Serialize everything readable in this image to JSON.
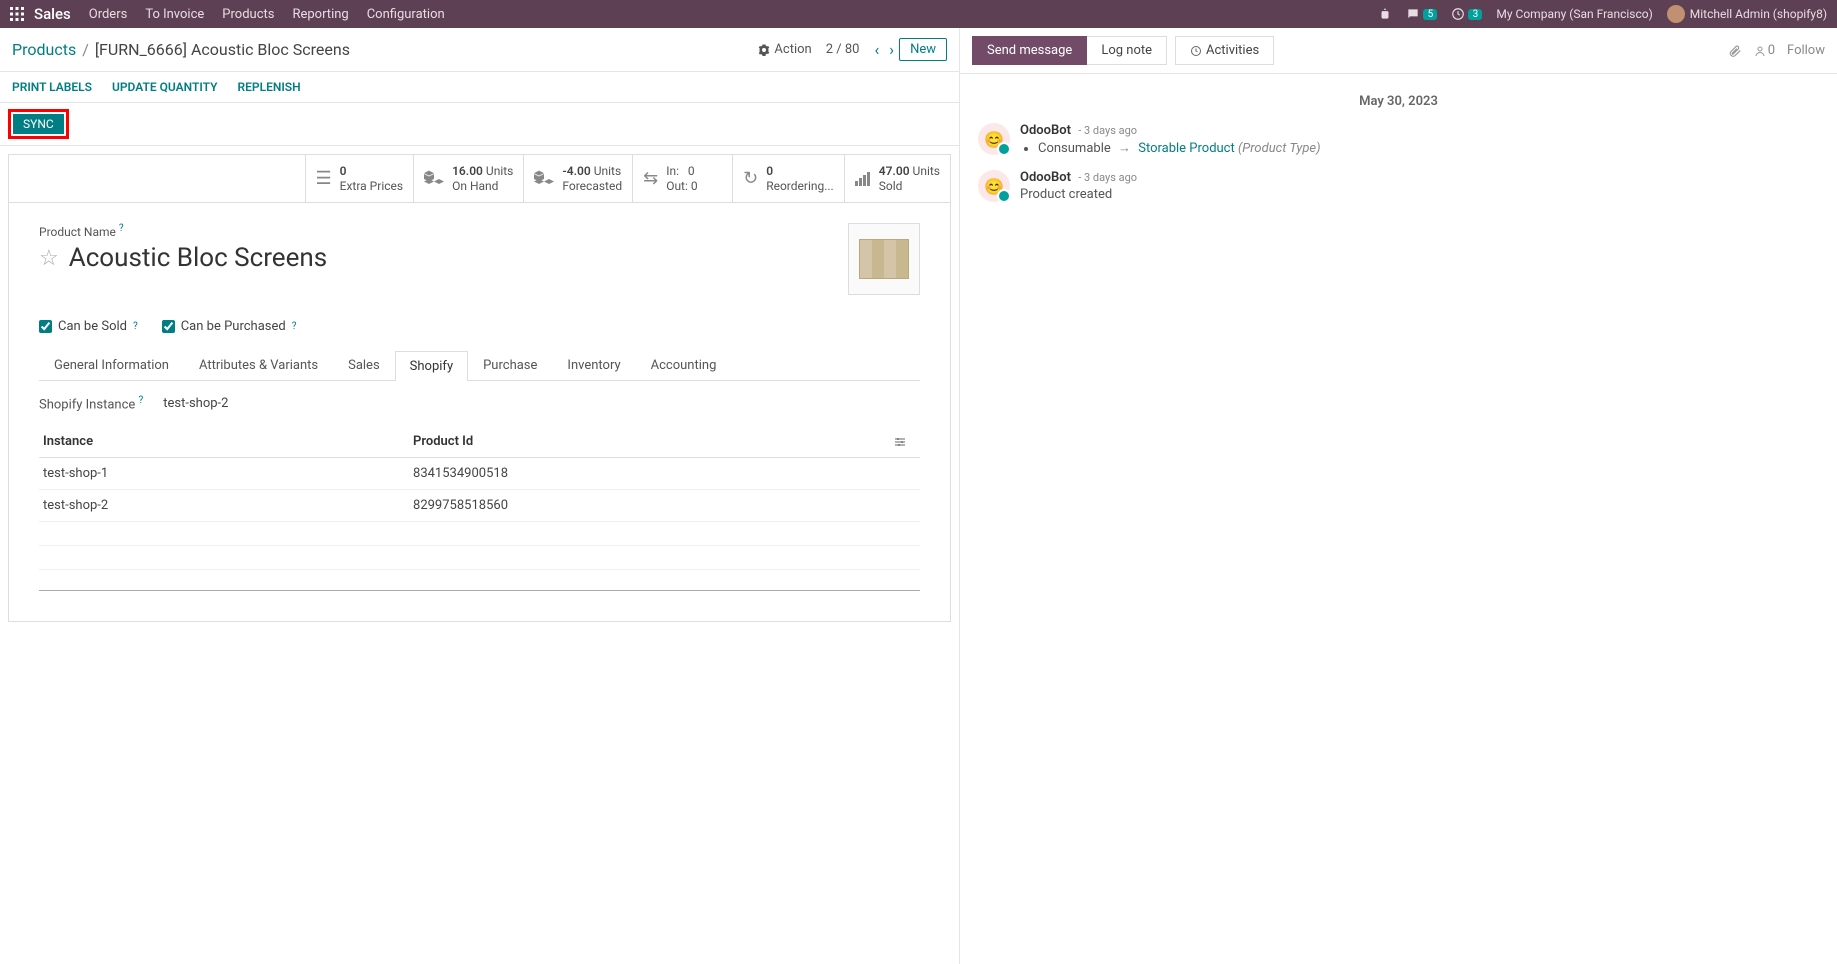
{
  "topbar": {
    "brand": "Sales",
    "menu": [
      "Orders",
      "To Invoice",
      "Products",
      "Reporting",
      "Configuration"
    ],
    "chat_badge": "5",
    "clock_badge": "3",
    "company": "My Company (San Francisco)",
    "user": "Mitchell Admin (shopify8)"
  },
  "breadcrumb": {
    "root": "Products",
    "current": "[FURN_6666] Acoustic Bloc Screens",
    "action_label": "Action",
    "pager": "2 / 80",
    "new_label": "New"
  },
  "action_buttons": {
    "print_labels": "PRINT LABELS",
    "update_qty": "UPDATE QUANTITY",
    "replenish": "REPLENISH",
    "sync": "SYNC"
  },
  "stats": {
    "extra_prices": {
      "num": "0",
      "label": "Extra Prices"
    },
    "on_hand": {
      "num": "16.00",
      "unit": "Units",
      "label": "On Hand"
    },
    "forecasted": {
      "num": "-4.00",
      "unit": "Units",
      "label": "Forecasted"
    },
    "in_out": {
      "in_label": "In:",
      "in": "0",
      "out_label": "Out:",
      "out": "0"
    },
    "reordering": {
      "num": "0",
      "label": "Reordering..."
    },
    "sold": {
      "num": "47.00",
      "unit": "Units",
      "label": "Sold"
    }
  },
  "product": {
    "name_label": "Product Name",
    "name": "Acoustic Bloc Screens",
    "can_be_sold_label": "Can be Sold",
    "can_be_purchased_label": "Can be Purchased"
  },
  "tabs": [
    "General Information",
    "Attributes & Variants",
    "Sales",
    "Shopify",
    "Purchase",
    "Inventory",
    "Accounting"
  ],
  "active_tab_index": 3,
  "shopify_tab": {
    "instance_label": "Shopify Instance",
    "instance_value": "test-shop-2",
    "columns": {
      "instance": "Instance",
      "product_id": "Product Id"
    },
    "rows": [
      {
        "instance": "test-shop-1",
        "product_id": "8341534900518"
      },
      {
        "instance": "test-shop-2",
        "product_id": "8299758518560"
      }
    ]
  },
  "chatter": {
    "send_message": "Send message",
    "log_note": "Log note",
    "activities": "Activities",
    "follower_count": "0",
    "follow": "Follow",
    "date": "May 30, 2023",
    "messages": [
      {
        "author": "OdooBot",
        "time": "- 3 days ago",
        "type": "change",
        "change_from": "Consumable",
        "change_to": "Storable Product",
        "change_meta": "(Product Type)"
      },
      {
        "author": "OdooBot",
        "time": "- 3 days ago",
        "type": "text",
        "text": "Product created"
      }
    ]
  }
}
